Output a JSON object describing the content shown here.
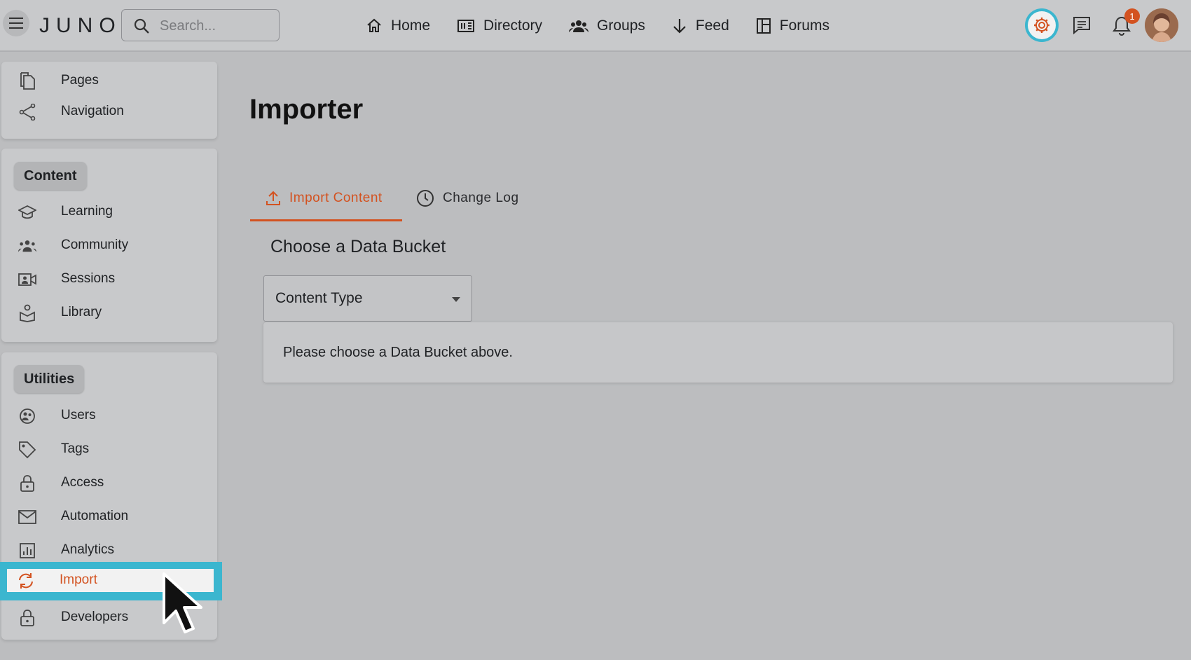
{
  "header": {
    "logo": "JUNO",
    "search_placeholder": "Search...",
    "nav": [
      {
        "label": "Home",
        "icon": "home-icon"
      },
      {
        "label": "Directory",
        "icon": "directory-icon"
      },
      {
        "label": "Groups",
        "icon": "groups-icon"
      },
      {
        "label": "Feed",
        "icon": "feed-icon"
      },
      {
        "label": "Forums",
        "icon": "forums-icon"
      }
    ],
    "notification_count": "1"
  },
  "sidebar": {
    "top_items": [
      {
        "label": "Pages",
        "icon": "pages-icon"
      },
      {
        "label": "Navigation",
        "icon": "share-icon"
      }
    ],
    "content_section": {
      "title": "Content",
      "items": [
        {
          "label": "Learning",
          "icon": "graduation-cap-icon"
        },
        {
          "label": "Community",
          "icon": "community-icon"
        },
        {
          "label": "Sessions",
          "icon": "video-icon"
        },
        {
          "label": "Library",
          "icon": "library-icon"
        }
      ]
    },
    "utilities_section": {
      "title": "Utilities",
      "items": [
        {
          "label": "Users",
          "icon": "users-icon"
        },
        {
          "label": "Tags",
          "icon": "tag-icon"
        },
        {
          "label": "Access",
          "icon": "lock-icon"
        },
        {
          "label": "Automation",
          "icon": "mail-icon"
        },
        {
          "label": "Analytics",
          "icon": "analytics-icon"
        },
        {
          "label": "Import",
          "icon": "sync-icon",
          "active": true
        },
        {
          "label": "Developers",
          "icon": "lock-icon"
        }
      ]
    }
  },
  "main": {
    "title": "Importer",
    "tabs": [
      {
        "label": "Import Content",
        "icon": "upload-icon",
        "active": true
      },
      {
        "label": "Change Log",
        "icon": "clock-icon",
        "active": false
      }
    ],
    "section_title": "Choose a Data Bucket",
    "select": {
      "label": "Content Type"
    },
    "info_message": "Please choose a Data Bucket above."
  },
  "colors": {
    "accent": "#d35220",
    "highlight": "#3bb6cf"
  }
}
